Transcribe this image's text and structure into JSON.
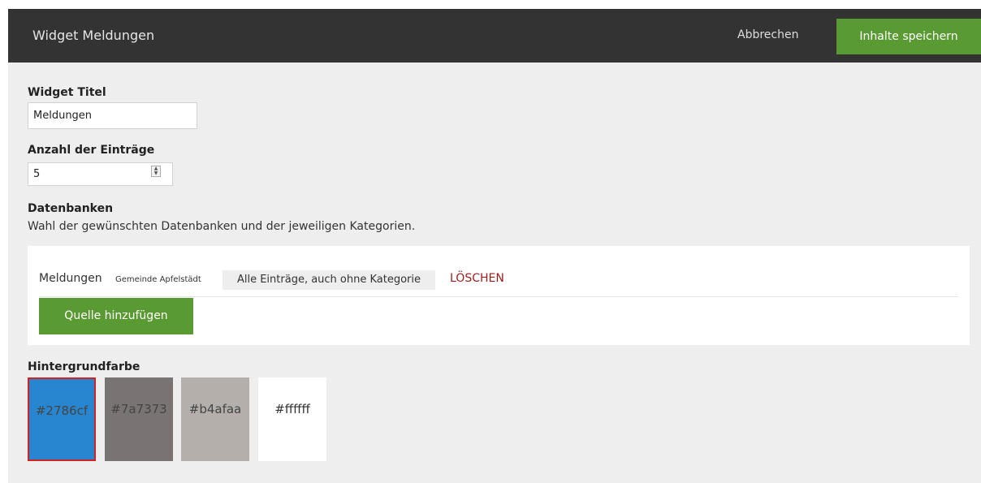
{
  "header": {
    "title": "Widget Meldungen",
    "cancel_label": "Abbrechen",
    "save_label": "Inhalte speichern"
  },
  "form": {
    "title_label": "Widget Titel",
    "title_value": "Meldungen",
    "count_label": "Anzahl der Einträge",
    "count_value": "5",
    "databases_label": "Datenbanken",
    "databases_description": "Wahl der gewünschten Datenbanken und der jeweiligen Kategorien."
  },
  "sources": {
    "items": [
      {
        "name": "Meldungen",
        "subtitle": "Gemeinde Apfelstädt",
        "category": "Alle Einträge, auch ohne Kategorie",
        "delete_label": "LÖSCHEN"
      }
    ],
    "add_label": "Quelle hinzufügen"
  },
  "background": {
    "label": "Hintergrundfarbe",
    "selected": "#2786cf",
    "swatches": [
      {
        "label": "#2786cf",
        "color": "#2786cf",
        "text_color": "#444444"
      },
      {
        "label": "#7a7373",
        "color": "#7a7373",
        "text_color": "#444444"
      },
      {
        "label": "#b4afaa",
        "color": "#b4afaa",
        "text_color": "#444444"
      },
      {
        "label": "#ffffff",
        "color": "#ffffff",
        "text_color": "#333333"
      }
    ]
  },
  "colors": {
    "topbar": "#333333",
    "accent_green": "#5a9a32",
    "delete_red": "#9b1c1c",
    "selected_border": "#d42222"
  }
}
